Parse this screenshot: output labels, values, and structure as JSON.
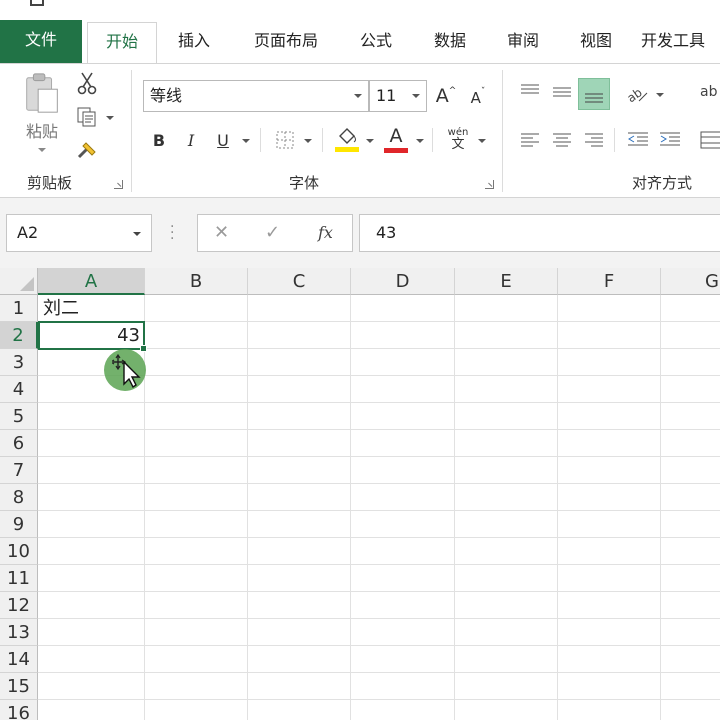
{
  "ribbon_tabs": [
    {
      "label": "文件"
    },
    {
      "label": "开始"
    },
    {
      "label": "插入"
    },
    {
      "label": "页面布局"
    },
    {
      "label": "公式"
    },
    {
      "label": "数据"
    },
    {
      "label": "审阅"
    },
    {
      "label": "视图"
    },
    {
      "label": "开发工具"
    }
  ],
  "clipboard": {
    "paste_label": "粘贴",
    "group_label": "剪贴板"
  },
  "font": {
    "font_name": "等线",
    "font_size": "11",
    "bold": "B",
    "italic": "I",
    "underline": "U",
    "grow": "A",
    "shrink": "A",
    "font_color_glyph": "A",
    "phonetic_top": "wén",
    "phonetic_bottom": "文",
    "group_label": "字体"
  },
  "alignment": {
    "group_label": "对齐方式",
    "wrap_glyph": "ab"
  },
  "formula_bar": {
    "name_box": "A2",
    "cancel_glyph": "✕",
    "enter_glyph": "✓",
    "fx_glyph": "fx",
    "value": "43"
  },
  "grid": {
    "columns": [
      "A",
      "B",
      "C",
      "D",
      "E",
      "F",
      "G"
    ],
    "rows": [
      "1",
      "2",
      "3",
      "4",
      "5",
      "6",
      "7",
      "8",
      "9",
      "10",
      "11",
      "12",
      "13",
      "14",
      "15",
      "16"
    ],
    "selected_cell": "A2",
    "cells": {
      "a1": "刘二",
      "a2": "43"
    }
  },
  "colors": {
    "accent": "#217346",
    "file_tab_bg": "#217346",
    "cursor_highlight": "#5aa352",
    "fill_color_swatch": "#ffe600",
    "font_color_swatch": "#e0262a"
  }
}
